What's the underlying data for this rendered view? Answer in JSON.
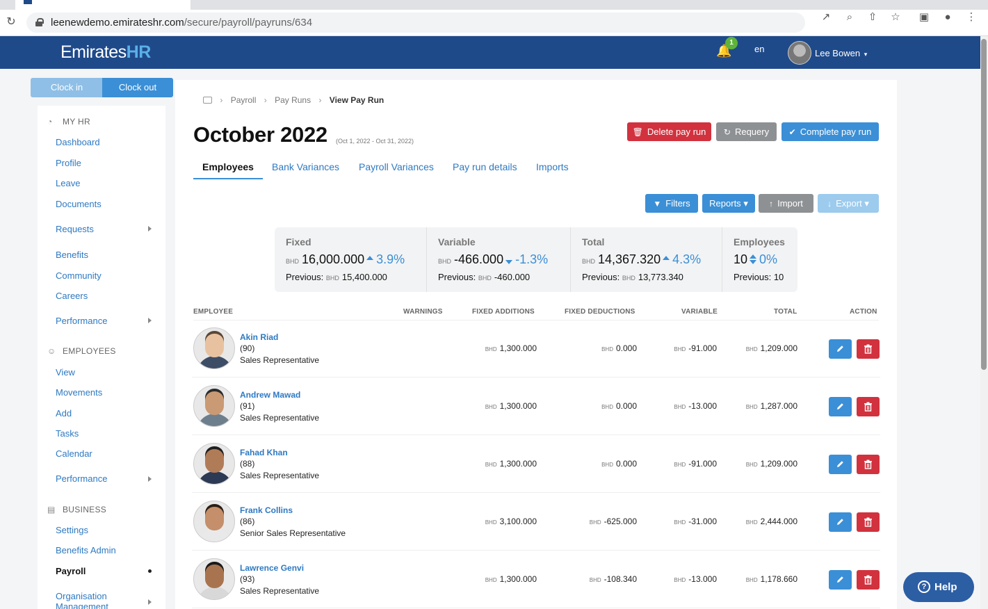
{
  "browser": {
    "url_host": "leenewdemo.emirateshr.com",
    "url_path": "/secure/payroll/payruns/634"
  },
  "header": {
    "logo_main": "Emirates",
    "logo_accent": "HR",
    "notification_count": "1",
    "language": "en",
    "user_name": "Lee Bowen"
  },
  "sidebar": {
    "clock_in": "Clock in",
    "clock_out": "Clock out",
    "my_hr": "MY HR",
    "my_hr_items": [
      "Dashboard",
      "Profile",
      "Leave",
      "Documents",
      "Requests",
      "Benefits",
      "Community",
      "Careers",
      "Performance"
    ],
    "employees": "EMPLOYEES",
    "employees_items": [
      "View",
      "Movements",
      "Add",
      "Tasks",
      "Calendar",
      "Performance"
    ],
    "business": "BUSINESS",
    "business_items": [
      "Settings",
      "Benefits Admin",
      "Payroll",
      "Organisation",
      "Management"
    ]
  },
  "breadcrumb": [
    "Payroll",
    "Pay Runs",
    "View Pay Run"
  ],
  "page": {
    "title": "October 2022",
    "subtitle": "(Oct 1, 2022 - Oct 31, 2022)",
    "delete_btn": "Delete pay run",
    "requery_btn": "Requery",
    "complete_btn": "Complete pay run"
  },
  "tabs": [
    "Employees",
    "Bank Variances",
    "Payroll Variances",
    "Pay run details",
    "Imports"
  ],
  "toolbar": {
    "filters": "Filters",
    "reports": "Reports",
    "import": "Import",
    "export": "Export"
  },
  "summary": {
    "currency": "BHD",
    "fixed": {
      "label": "Fixed",
      "value": "16,000.000",
      "pct": "3.9%",
      "prev_label": "Previous:",
      "prev": "15,400.000"
    },
    "variable": {
      "label": "Variable",
      "value": "-466.000",
      "pct": "-1.3%",
      "prev_label": "Previous:",
      "prev": "-460.000"
    },
    "total": {
      "label": "Total",
      "value": "14,367.320",
      "pct": "4.3%",
      "prev_label": "Previous:",
      "prev": "13,773.340"
    },
    "employees": {
      "label": "Employees",
      "value": "10",
      "pct": "0%",
      "prev_label": "Previous:",
      "prev": "10"
    }
  },
  "table": {
    "columns": [
      "EMPLOYEE",
      "WARNINGS",
      "FIXED ADDITIONS",
      "FIXED DEDUCTIONS",
      "VARIABLE",
      "TOTAL",
      "ACTION"
    ],
    "currency": "BHD",
    "rows": [
      {
        "name": "Akin Riad",
        "id": "(90)",
        "job": "Sales Representative",
        "fixed_add": "1,300.000",
        "fixed_ded": "0.000",
        "variable": "-91.000",
        "total": "1,209.000"
      },
      {
        "name": "Andrew Mawad",
        "id": "(91)",
        "job": "Sales Representative",
        "fixed_add": "1,300.000",
        "fixed_ded": "0.000",
        "variable": "-13.000",
        "total": "1,287.000"
      },
      {
        "name": "Fahad Khan",
        "id": "(88)",
        "job": "Sales Representative",
        "fixed_add": "1,300.000",
        "fixed_ded": "0.000",
        "variable": "-91.000",
        "total": "1,209.000"
      },
      {
        "name": "Frank Collins",
        "id": "(86)",
        "job": "Senior Sales Representative",
        "fixed_add": "3,100.000",
        "fixed_ded": "-625.000",
        "variable": "-31.000",
        "total": "2,444.000"
      },
      {
        "name": "Lawrence Genvi",
        "id": "(93)",
        "job": "Sales Representative",
        "fixed_add": "1,300.000",
        "fixed_ded": "-108.340",
        "variable": "-13.000",
        "total": "1,178.660"
      }
    ]
  },
  "help": "Help",
  "colors": {
    "brand": "#1f4a8a",
    "link": "#2d79c2",
    "primary": "#3b8fd6",
    "danger": "#d1323e",
    "neutral": "#8e9194"
  }
}
